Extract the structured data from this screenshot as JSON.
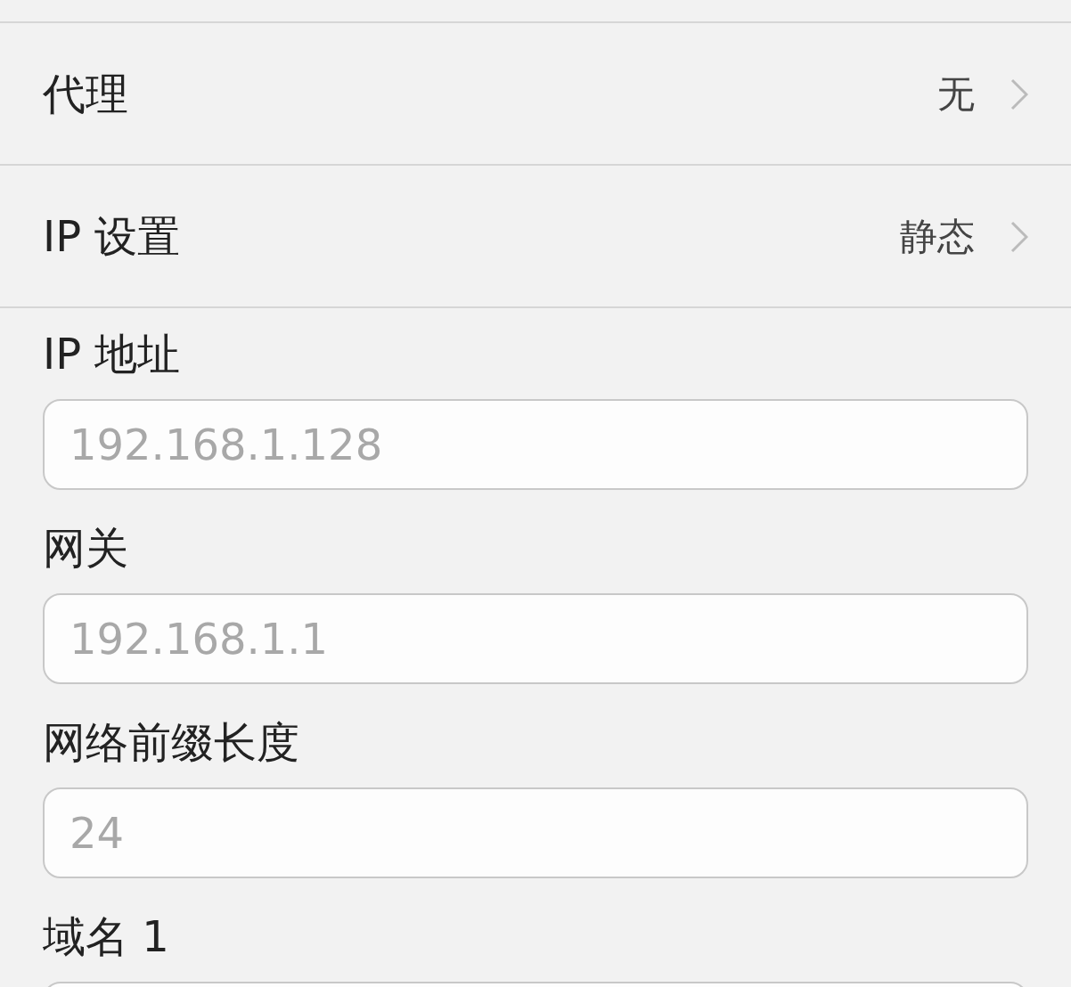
{
  "settings": [
    {
      "label": "代理",
      "value": "无"
    },
    {
      "label": "IP 设置",
      "value": "静态"
    }
  ],
  "fields": [
    {
      "label": "IP 地址",
      "placeholder": "192.168.1.128"
    },
    {
      "label": "网关",
      "placeholder": "192.168.1.1"
    },
    {
      "label": "网络前缀长度",
      "placeholder": "24"
    },
    {
      "label": "域名 1"
    }
  ]
}
